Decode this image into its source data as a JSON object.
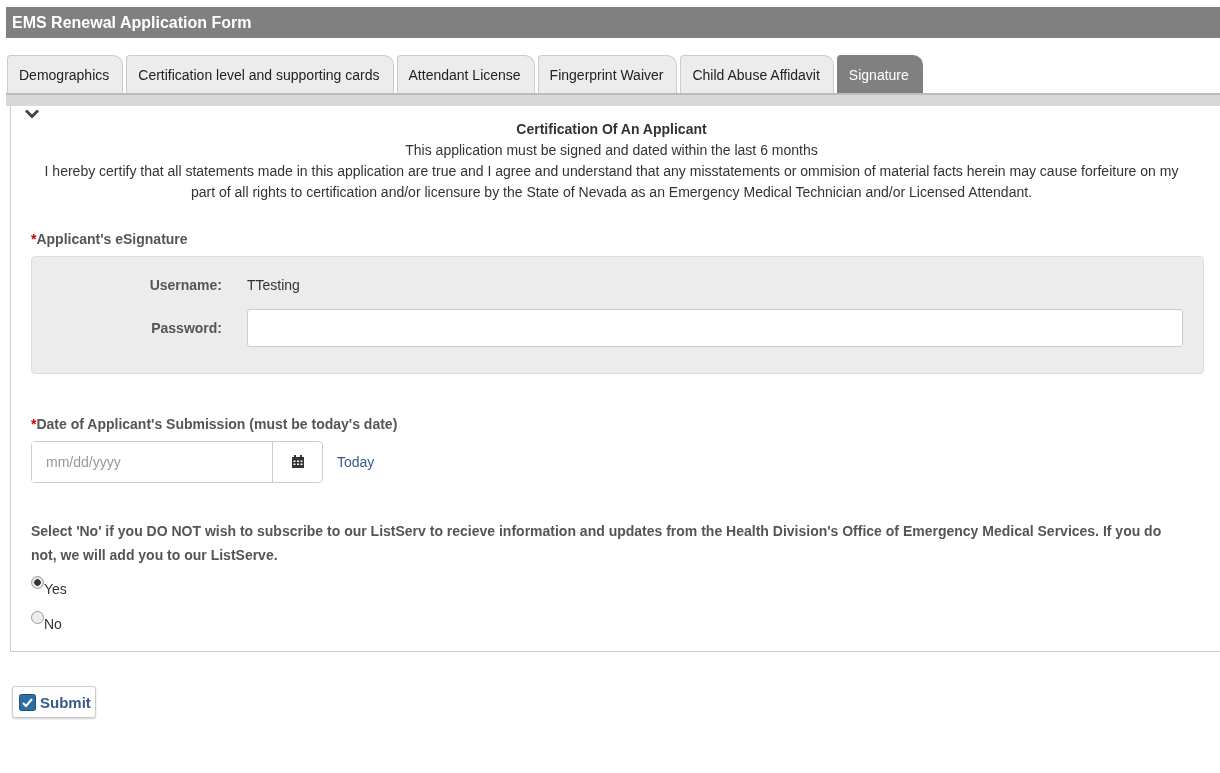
{
  "window": {
    "title": "EMS Renewal Application Form"
  },
  "tabs": [
    {
      "label": "Demographics",
      "selected": false
    },
    {
      "label": "Certification level and supporting cards",
      "selected": false
    },
    {
      "label": "Attendant License",
      "selected": false
    },
    {
      "label": "Fingerprint Waiver",
      "selected": false
    },
    {
      "label": "Child Abuse Affidavit",
      "selected": false
    },
    {
      "label": "Signature",
      "selected": true
    }
  ],
  "section": {
    "expanded": true,
    "heading": "Certification Of An Applicant",
    "subheading": "This application must be signed and dated within the last 6 months",
    "statement": "I hereby certify that all statements made in this application are true and I agree and understand that any misstatements or ommision of material facts herein may cause forfeiture on my part of all rights to certification and/or licensure by the State of Nevada as an Emergency Medical Technician and/or Licensed Attendant."
  },
  "esignature": {
    "required_mark": "*",
    "label": "Applicant's eSignature",
    "username_label": "Username:",
    "username": "TTesting",
    "password_label": "Password:"
  },
  "date": {
    "required_mark": "*",
    "label": "Date of Applicant's Submission (must be today's date)",
    "placeholder": "mm/dd/yyyy",
    "today_link": "Today"
  },
  "listserv": {
    "question": "Select 'No' if you DO NOT wish to subscribe to our ListServ to recieve information and updates from the Health Division's Office of Emergency Medical Services. If you do not, we will add you to our ListServe.",
    "options": [
      {
        "label": "Yes",
        "selected": true
      },
      {
        "label": "No",
        "selected": false
      }
    ]
  },
  "submit_button": "Submit"
}
